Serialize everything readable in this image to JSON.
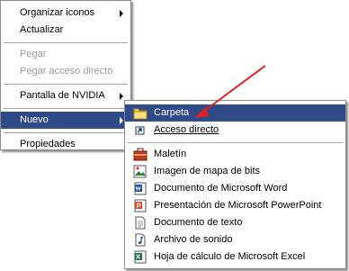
{
  "context_menu": {
    "items": [
      {
        "label": "Organizar iconos",
        "submenu": true,
        "disabled": false
      },
      {
        "label": "Actualizar",
        "submenu": false,
        "disabled": false
      },
      {
        "label": "Pegar",
        "submenu": false,
        "disabled": true
      },
      {
        "label": "Pegar acceso directo",
        "submenu": false,
        "disabled": true
      },
      {
        "label": "Pantalla de NVIDIA",
        "submenu": true,
        "disabled": false
      },
      {
        "label": "Nuevo",
        "submenu": true,
        "disabled": false,
        "selected": true
      },
      {
        "label": "Propiedades",
        "submenu": false,
        "disabled": false
      }
    ]
  },
  "new_submenu": {
    "items": [
      {
        "label": "Carpeta",
        "icon": "folder-icon",
        "selected": true
      },
      {
        "label": "Acceso directo",
        "icon": "shortcut-icon"
      },
      {
        "label": "Maletín",
        "icon": "briefcase-icon"
      },
      {
        "label": "Imagen de mapa de bits",
        "icon": "bitmap-icon"
      },
      {
        "label": "Documento de Microsoft Word",
        "icon": "word-icon"
      },
      {
        "label": "Presentación de Microsoft PowerPoint",
        "icon": "powerpoint-icon"
      },
      {
        "label": "Documento de texto",
        "icon": "text-document-icon"
      },
      {
        "label": "Archivo de sonido",
        "icon": "sound-file-icon"
      },
      {
        "label": "Hoja de cálculo de Microsoft Excel",
        "icon": "excel-icon"
      }
    ]
  },
  "colors": {
    "selection": "#2f4a86",
    "arrow_annotation": "#e0201f"
  }
}
